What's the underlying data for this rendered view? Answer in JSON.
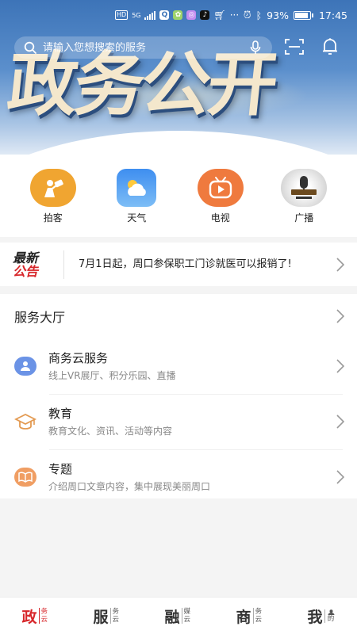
{
  "status_bar": {
    "hd": "HD",
    "network": "5G",
    "battery_percent": "93%",
    "time": "17:45",
    "more": "···"
  },
  "search": {
    "placeholder": "请输入您想搜索的服务"
  },
  "banner": {
    "title": "政务公开"
  },
  "quick_links": [
    {
      "label": "拍客",
      "icon": "camera-person-icon",
      "color": "#f0a531"
    },
    {
      "label": "天气",
      "icon": "weather-icon",
      "color": "#4aa3ef"
    },
    {
      "label": "电视",
      "icon": "tv-icon",
      "color": "#ef7a3e"
    },
    {
      "label": "广播",
      "icon": "radio-microphone-icon",
      "color": "#d8d8d8"
    }
  ],
  "notice": {
    "badge_line1": "最新",
    "badge_line2": "公告",
    "text": "7月1日起，周口参保职工门诊就医可以报销了!"
  },
  "service_hall": {
    "title": "服务大厅",
    "items": [
      {
        "title": "商务云服务",
        "subtitle": "线上VR展厅、积分乐园、直播",
        "icon": "user-card-icon",
        "color": "#5c87e0"
      },
      {
        "title": "教育",
        "subtitle": "教育文化、资讯、活动等内容",
        "icon": "graduation-cap-icon",
        "color": "#e8a25a"
      },
      {
        "title": "专题",
        "subtitle": "介绍周口文章内容，集中展现美丽周口",
        "icon": "open-book-icon",
        "color": "#f0a06a"
      }
    ]
  },
  "bottom_nav": [
    {
      "big": "政",
      "small": "务云",
      "active": true
    },
    {
      "big": "服",
      "small": "务云",
      "active": false
    },
    {
      "big": "融",
      "small": "媒云",
      "active": false
    },
    {
      "big": "商",
      "small": "务云",
      "active": false
    },
    {
      "big": "我",
      "small": "的",
      "active": false
    }
  ],
  "colors": {
    "accent_red": "#d7262a",
    "banner_blue": "#3d74b8"
  }
}
